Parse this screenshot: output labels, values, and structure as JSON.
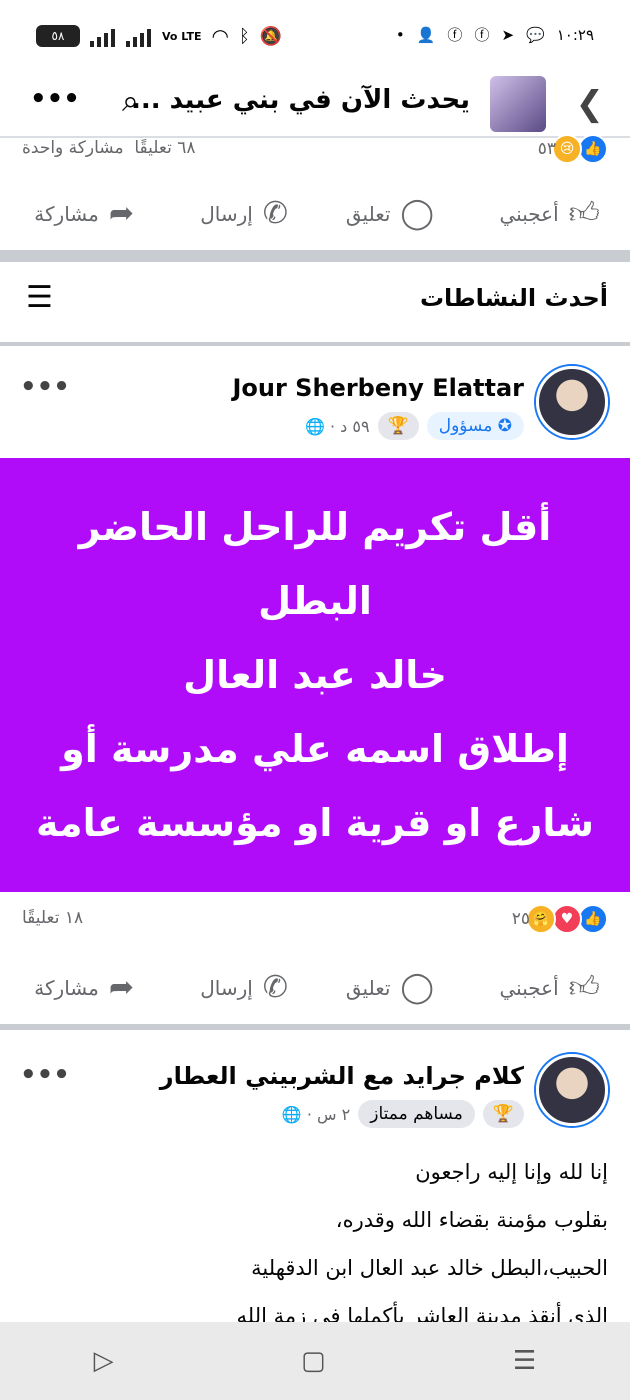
{
  "status_bar": {
    "time": "١٠:٢٩",
    "battery": "٥٨",
    "network": "Vo LTE"
  },
  "header": {
    "title": "يحدث الآن في بني عبيد ...",
    "back_icon": "chevron-right-icon",
    "search_icon": "search-icon",
    "more_icon": "more-dots-icon"
  },
  "prev_post": {
    "reactions_count": "٥٣",
    "comments": "٦٨ تعليقًا",
    "shares": "مشاركة واحدة"
  },
  "actions": {
    "like": "أعجبني",
    "comment": "تعليق",
    "send": "إرسال",
    "share": "مشاركة"
  },
  "section": {
    "title": "أحدث النشاطات"
  },
  "post1": {
    "author": "Jour Sherbeny Elattar",
    "badge": "مسؤول",
    "time": "٥٩ د",
    "lines": [
      "أقل تكريم للراحل الحاضر",
      "البطل",
      "خالد عبد العال",
      "إطلاق اسمه علي مدرسة أو",
      "شارع او قرية او مؤسسة عامة"
    ],
    "reactions_count": "٢٥",
    "comments": "١٨ تعليقًا"
  },
  "post2": {
    "author": "كلام جرايد مع الشربيني العطار",
    "badge": "مساهم ممتاز",
    "time": "٢ س",
    "lines": [
      "إنا لله وإنا إليه راجعون",
      "بقلوب مؤمنة بقضاء الله وقدره،",
      "الحبيب،البطل خالد عبد العال ابن الدقهلية",
      "الذي أنقذ مدينة العاشر بأكملها في زمة الله"
    ]
  },
  "colors": {
    "accent": "#1877f2",
    "card_bg": "#b10cfa",
    "divider": "#c9ccd1"
  }
}
